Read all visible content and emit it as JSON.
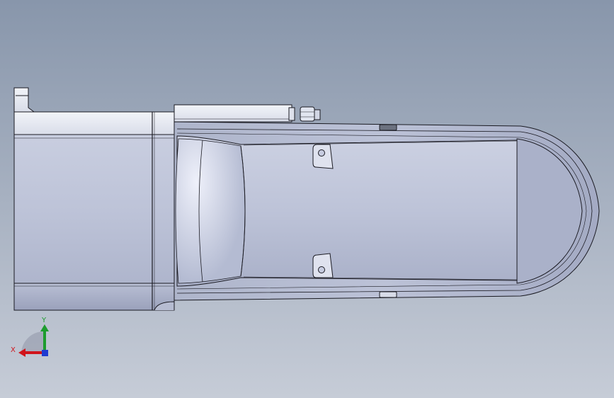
{
  "viewport": {
    "colors": {
      "bg_top": "#8896ab",
      "bg_bottom": "#c6ccd7"
    }
  },
  "model": {
    "colors": {
      "edge": "#1a1a22",
      "face_light": "#e6e9f3",
      "face_mid": "#c3c9dc",
      "face_dark": "#a9b0c8",
      "face_shadow": "#8e96b0",
      "slot": "#6c7280"
    }
  },
  "triad": {
    "x_label": "X",
    "y_label": "Y",
    "colors": {
      "x": "#d0141b",
      "y": "#1d9c2e",
      "z": "#1f3bd0",
      "label_x": "#d0141b",
      "label_y": "#1d9c2e"
    }
  }
}
